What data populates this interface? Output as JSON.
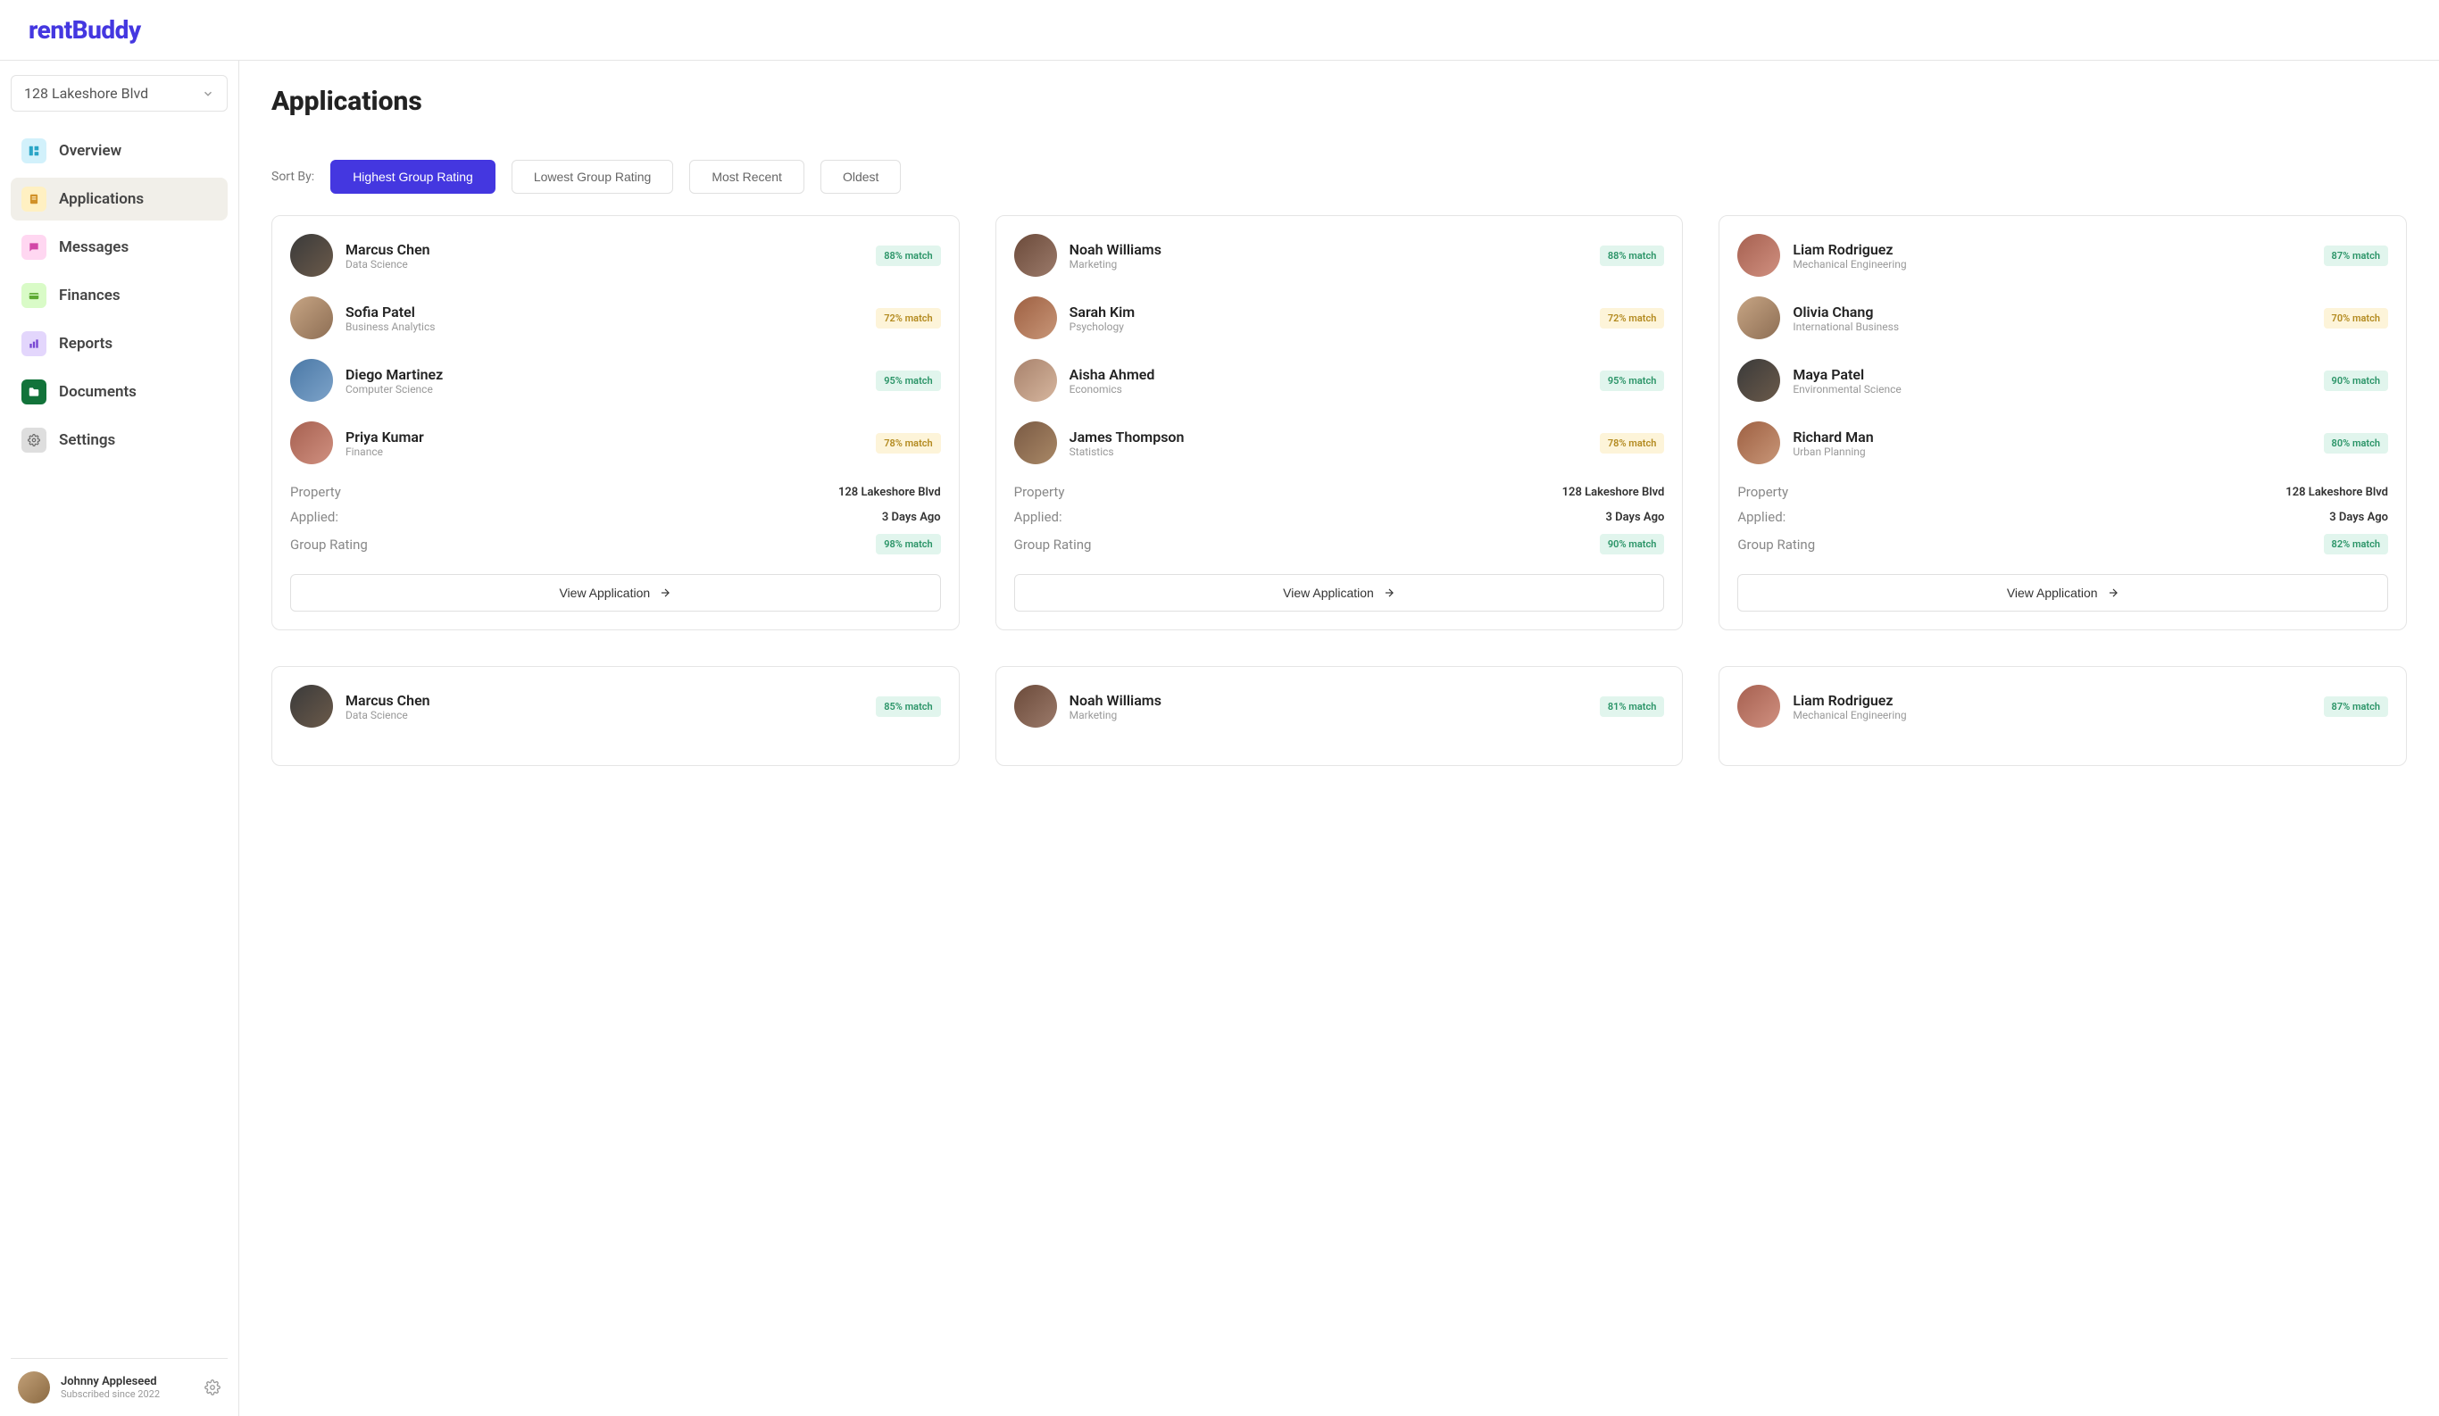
{
  "brand": "rentBuddy",
  "property_selector": {
    "value": "128 Lakeshore Blvd"
  },
  "sidebar": {
    "items": [
      {
        "label": "Overview"
      },
      {
        "label": "Applications"
      },
      {
        "label": "Messages"
      },
      {
        "label": "Finances"
      },
      {
        "label": "Reports"
      },
      {
        "label": "Documents"
      },
      {
        "label": "Settings"
      }
    ]
  },
  "user": {
    "name": "Johnny Appleseed",
    "since": "Subscribed since 2022"
  },
  "page_title": "Applications",
  "sort": {
    "label": "Sort By:",
    "options": [
      "Highest Group Rating",
      "Lowest Group Rating",
      "Most Recent",
      "Oldest"
    ],
    "active": 0
  },
  "meta_labels": {
    "property": "Property",
    "applied": "Applied:",
    "group_rating": "Group Rating",
    "view_button": "View Application"
  },
  "cards": [
    {
      "applicants": [
        {
          "name": "Marcus Chen",
          "major": "Data Science",
          "match": "88% match",
          "match_type": "green",
          "av": "a"
        },
        {
          "name": "Sofia Patel",
          "major": "Business Analytics",
          "match": "72% match",
          "match_type": "yellow",
          "av": "b"
        },
        {
          "name": "Diego Martinez",
          "major": "Computer Science",
          "match": "95% match",
          "match_type": "green",
          "av": "c"
        },
        {
          "name": "Priya Kumar",
          "major": "Finance",
          "match": "78% match",
          "match_type": "yellow",
          "av": "d"
        }
      ],
      "property": "128 Lakeshore Blvd",
      "applied": "3 Days Ago",
      "group_match": "98% match",
      "group_match_type": "green"
    },
    {
      "applicants": [
        {
          "name": "Noah Williams",
          "major": "Marketing",
          "match": "88% match",
          "match_type": "green",
          "av": "e"
        },
        {
          "name": "Sarah Kim",
          "major": "Psychology",
          "match": "72% match",
          "match_type": "yellow",
          "av": "f"
        },
        {
          "name": "Aisha Ahmed",
          "major": "Economics",
          "match": "95% match",
          "match_type": "green",
          "av": "g"
        },
        {
          "name": "James Thompson",
          "major": "Statistics",
          "match": "78% match",
          "match_type": "yellow",
          "av": "h"
        }
      ],
      "property": "128 Lakeshore Blvd",
      "applied": "3 Days Ago",
      "group_match": "90% match",
      "group_match_type": "green"
    },
    {
      "applicants": [
        {
          "name": "Liam Rodriguez",
          "major": "Mechanical Engineering",
          "match": "87% match",
          "match_type": "green",
          "av": "d"
        },
        {
          "name": "Olivia Chang",
          "major": "International Business",
          "match": "70% match",
          "match_type": "yellow",
          "av": "b"
        },
        {
          "name": "Maya Patel",
          "major": "Environmental Science",
          "match": "90% match",
          "match_type": "green",
          "av": "a"
        },
        {
          "name": "Richard Man",
          "major": "Urban Planning",
          "match": "80% match",
          "match_type": "green",
          "av": "f"
        }
      ],
      "property": "128 Lakeshore Blvd",
      "applied": "3 Days Ago",
      "group_match": "82% match",
      "group_match_type": "green"
    },
    {
      "applicants": [
        {
          "name": "Marcus Chen",
          "major": "Data Science",
          "match": "85% match",
          "match_type": "green",
          "av": "a"
        }
      ]
    },
    {
      "applicants": [
        {
          "name": "Noah Williams",
          "major": "Marketing",
          "match": "81% match",
          "match_type": "green",
          "av": "e"
        }
      ]
    },
    {
      "applicants": [
        {
          "name": "Liam Rodriguez",
          "major": "Mechanical Engineering",
          "match": "87% match",
          "match_type": "green",
          "av": "d"
        }
      ]
    }
  ]
}
